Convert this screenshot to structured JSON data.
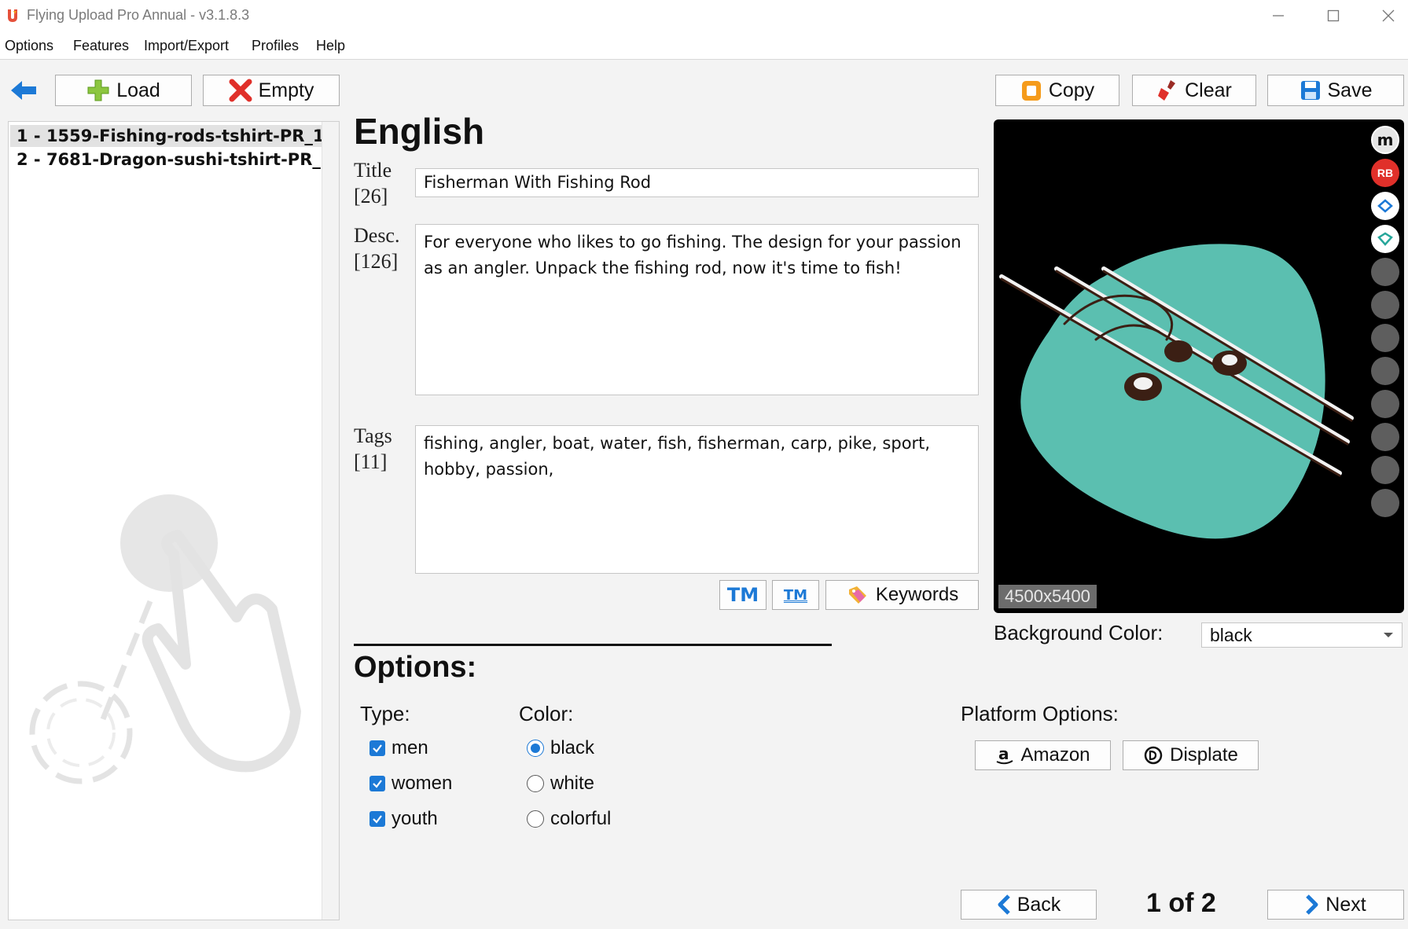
{
  "window": {
    "title": "Flying Upload Pro Annual - v3.1.8.3"
  },
  "menu": [
    "Options",
    "Features",
    "Import/Export",
    "Profiles",
    "Help"
  ],
  "toolbar": {
    "load": "Load",
    "empty": "Empty",
    "copy": "Copy",
    "clear": "Clear",
    "save": "Save"
  },
  "files": [
    "1 - 1559-Fishing-rods-tshirt-PR_1",
    "2 - 7681-Dragon-sushi-tshirt-PR_"
  ],
  "editor": {
    "language": "English",
    "title_label": "Title",
    "title_count": "[26]",
    "title_value": "Fisherman With Fishing Rod",
    "desc_label": "Desc.",
    "desc_count": "[126]",
    "desc_value": "For everyone who likes to go fishing. The design for your passion as an angler. Unpack the fishing rod, now it's time to fish!",
    "tags_label": "Tags",
    "tags_count": "[11]",
    "tags_value": "fishing, angler, boat, water, fish, fisherman, carp, pike, sport, hobby, passion,",
    "tm_label": "TM",
    "tm_list_label": "TM",
    "keywords_label": "Keywords"
  },
  "preview": {
    "dimensions": "4500x5400",
    "background_label": "Background Color:",
    "background_value": "black",
    "platform_icons": [
      "merch-icon",
      "redbubble-icon",
      "spreadshirt-icon",
      "teepublic-icon",
      "shirtee-icon",
      "society6-icon",
      "zazzle-icon",
      "printful-icon",
      "displate-icon",
      "spring-icon",
      "generic-platform-icon",
      "generic-platform-icon-2"
    ]
  },
  "options": {
    "heading": "Options:",
    "type_label": "Type:",
    "types": [
      {
        "label": "men",
        "checked": true
      },
      {
        "label": "women",
        "checked": true
      },
      {
        "label": "youth",
        "checked": true
      }
    ],
    "color_label": "Color:",
    "colors": [
      {
        "label": "black",
        "checked": true
      },
      {
        "label": "white",
        "checked": false
      },
      {
        "label": "colorful",
        "checked": false
      }
    ],
    "platform_label": "Platform Options:",
    "amazon": "Amazon",
    "displate": "Displate"
  },
  "nav": {
    "back": "Back",
    "next": "Next",
    "counter": "1 of 2"
  },
  "colors": {
    "accent_blue": "#1c79d6",
    "teal_blob": "#5bbfb0",
    "clear_red": "#e0302a",
    "copy_orange": "#f59b1b"
  }
}
